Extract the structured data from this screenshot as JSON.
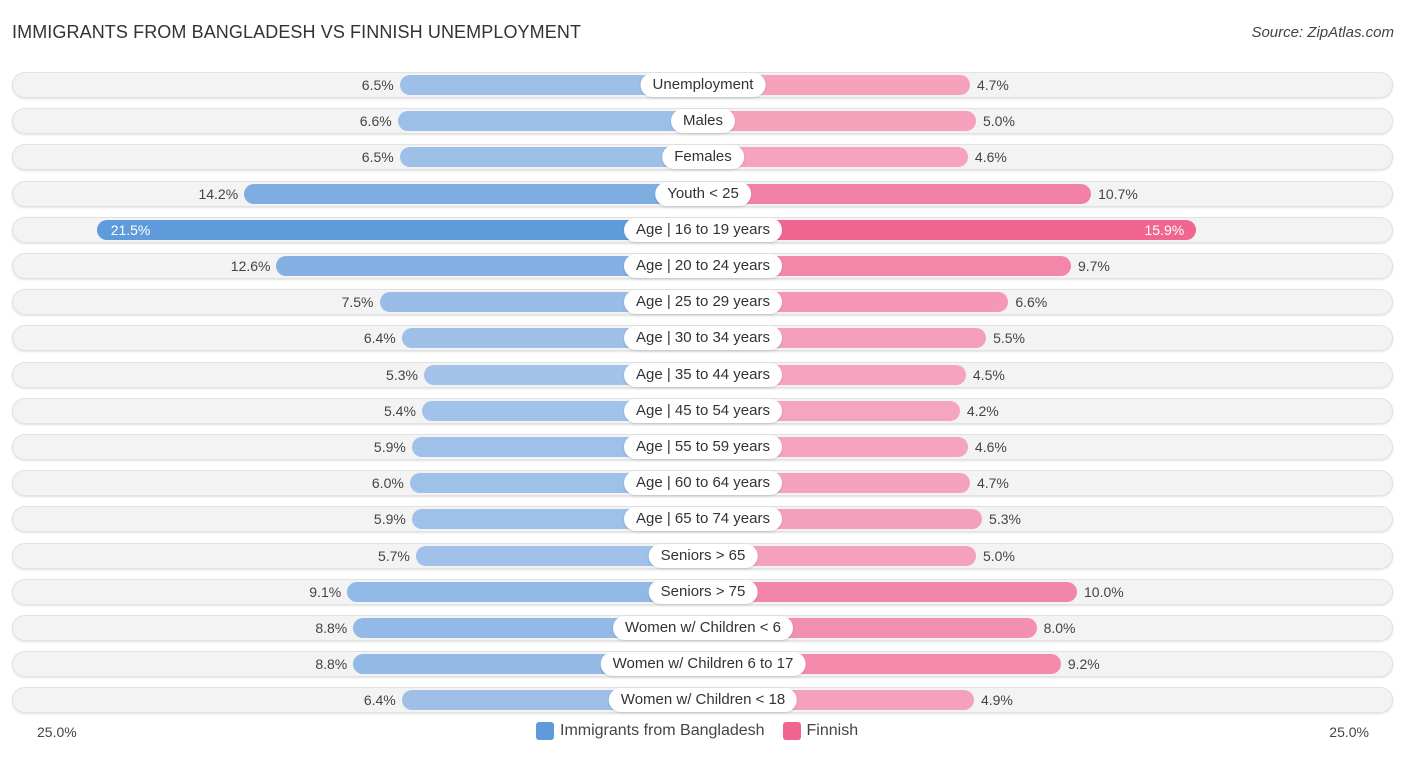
{
  "header": {
    "title": "IMMIGRANTS FROM BANGLADESH VS FINNISH UNEMPLOYMENT",
    "source": "Source: ZipAtlas.com"
  },
  "colors": {
    "left_light": "#a7c5ea",
    "left_strong": "#5f9bdb",
    "right_light": "#f5a6c0",
    "right_strong": "#f06690"
  },
  "chart_data": {
    "type": "bar",
    "orientation": "horizontal-diverging",
    "title": "IMMIGRANTS FROM BANGLADESH VS FINNISH UNEMPLOYMENT",
    "categories": [
      "Unemployment",
      "Males",
      "Females",
      "Youth < 25",
      "Age | 16 to 19 years",
      "Age | 20 to 24 years",
      "Age | 25 to 29 years",
      "Age | 30 to 34 years",
      "Age | 35 to 44 years",
      "Age | 45 to 54 years",
      "Age | 55 to 59 years",
      "Age | 60 to 64 years",
      "Age | 65 to 74 years",
      "Seniors > 65",
      "Seniors > 75",
      "Women w/ Children < 6",
      "Women w/ Children 6 to 17",
      "Women w/ Children < 18"
    ],
    "series": [
      {
        "name": "Immigrants from Bangladesh",
        "side": "left",
        "values": [
          6.5,
          6.6,
          6.5,
          14.2,
          21.5,
          12.6,
          7.5,
          6.4,
          5.3,
          5.4,
          5.9,
          6.0,
          5.9,
          5.7,
          9.1,
          8.8,
          8.8,
          6.4
        ]
      },
      {
        "name": "Finnish",
        "side": "right",
        "values": [
          4.7,
          5.0,
          4.6,
          10.7,
          15.9,
          9.7,
          6.6,
          5.5,
          4.5,
          4.2,
          4.6,
          4.7,
          5.3,
          5.0,
          10.0,
          8.0,
          9.2,
          4.9
        ]
      }
    ],
    "value_labels_left": [
      "6.5%",
      "6.6%",
      "6.5%",
      "14.2%",
      "21.5%",
      "12.6%",
      "7.5%",
      "6.4%",
      "5.3%",
      "5.4%",
      "5.9%",
      "6.0%",
      "5.9%",
      "5.7%",
      "9.1%",
      "8.8%",
      "8.8%",
      "6.4%"
    ],
    "value_labels_right": [
      "4.7%",
      "5.0%",
      "4.6%",
      "10.7%",
      "15.9%",
      "9.7%",
      "6.6%",
      "5.5%",
      "4.5%",
      "4.2%",
      "4.6%",
      "4.7%",
      "5.3%",
      "5.0%",
      "10.0%",
      "8.0%",
      "9.2%",
      "4.9%"
    ],
    "axis_min_label": "25.0%",
    "axis_max_label": "25.0%",
    "xlim": [
      25.0,
      25.0
    ],
    "legend": {
      "placement": "bottom-center",
      "entries": [
        "Immigrants from Bangladesh",
        "Finnish"
      ]
    },
    "highlight_index": 4,
    "unit": "%"
  }
}
